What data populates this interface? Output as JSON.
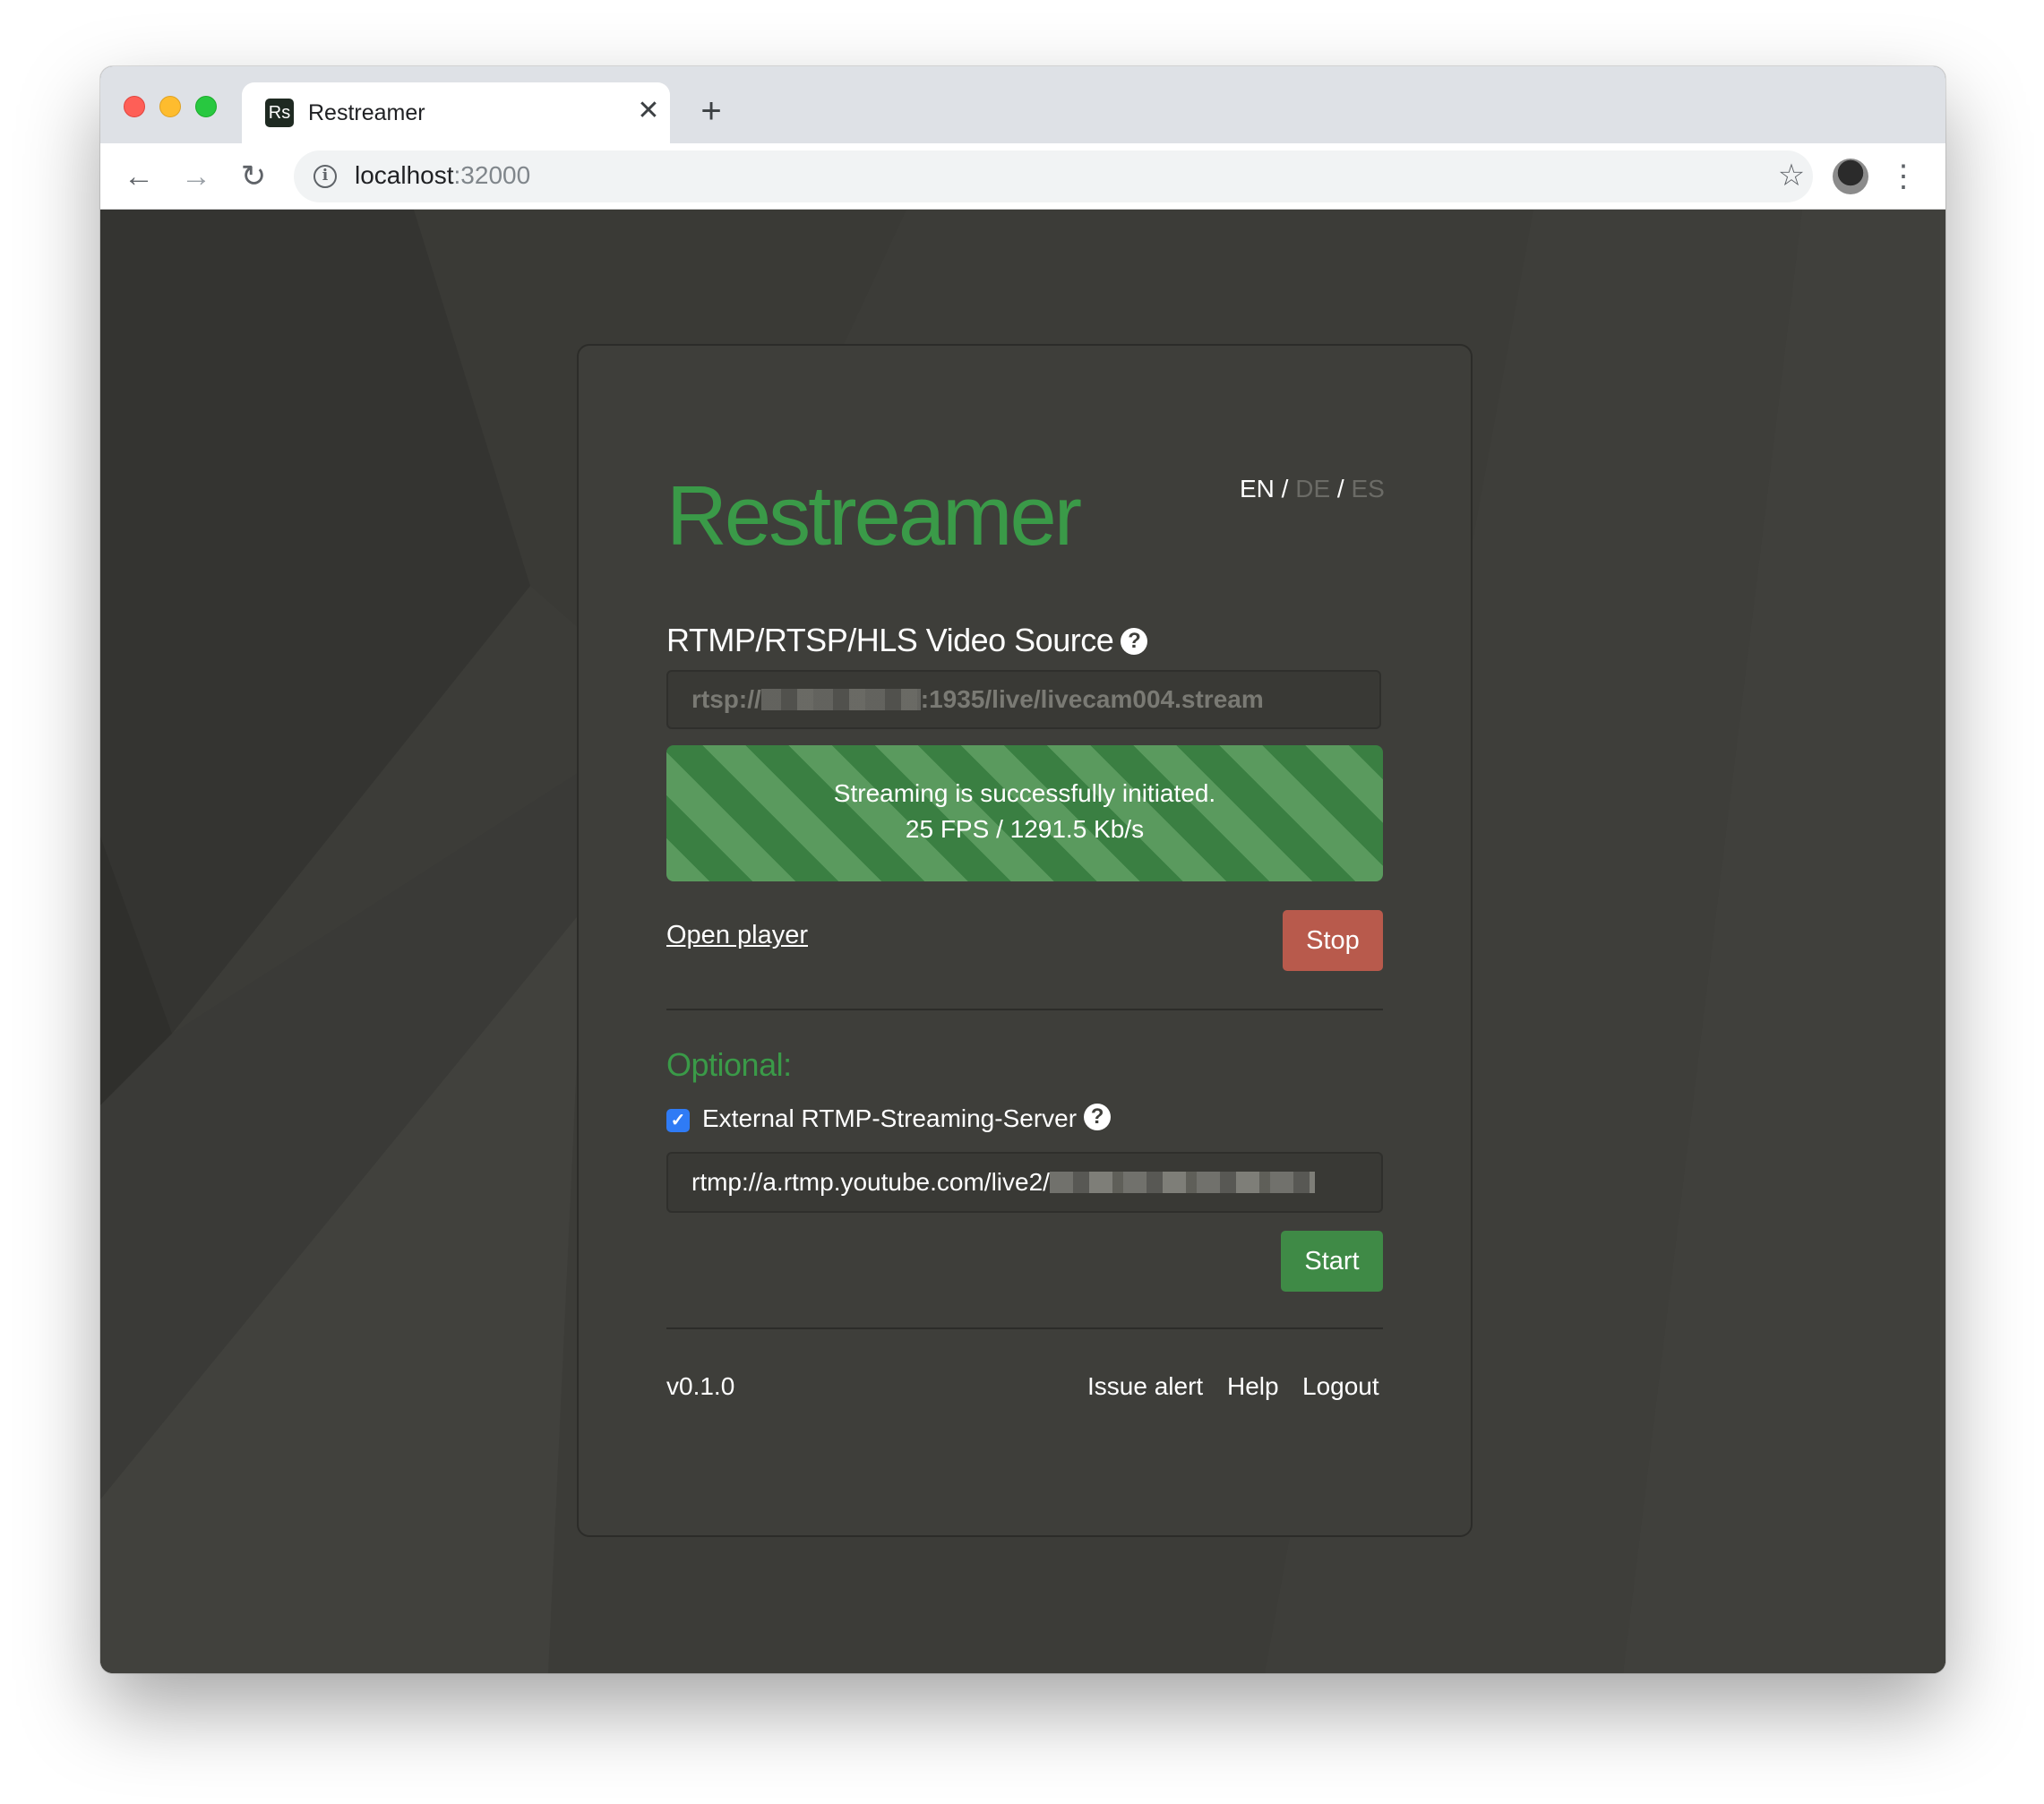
{
  "browser": {
    "tab_title": "Restreamer",
    "favicon_text": "Rs",
    "tab_close": "✕",
    "new_tab": "+",
    "url_host": "localhost",
    "url_port": ":32000",
    "back": "←",
    "forward": "→",
    "reload": "↻",
    "info": "i",
    "star": "☆",
    "menu": "⋮"
  },
  "app": {
    "logo": "Restreamer",
    "lang": {
      "en": "EN",
      "de": "DE",
      "es": "ES",
      "sep": " / "
    },
    "source_label": "RTMP/RTSP/HLS Video Source",
    "help_glyph": "?",
    "source_value_prefix": "rtsp://",
    "source_value_suffix": ":1935/live/livecam004.stream",
    "status_line1": "Streaming is successfully initiated.",
    "status_line2": "25 FPS / 1291.5 Kb/s",
    "open_player": "Open player",
    "stop_label": "Stop",
    "optional_label": "Optional:",
    "external_label": "External RTMP-Streaming-Server",
    "external_checked": true,
    "checkmark": "✓",
    "external_value_prefix": "rtmp://a.rtmp.youtube.com/live2/",
    "start_label": "Start",
    "version": "v0.1.0",
    "footer": {
      "issue": "Issue alert",
      "help": "Help",
      "logout": "Logout"
    },
    "colors": {
      "accent_green": "#3a9a48",
      "stop_red": "#b85a4c",
      "start_green": "#3f8a46",
      "background": "#3c3c38"
    }
  }
}
